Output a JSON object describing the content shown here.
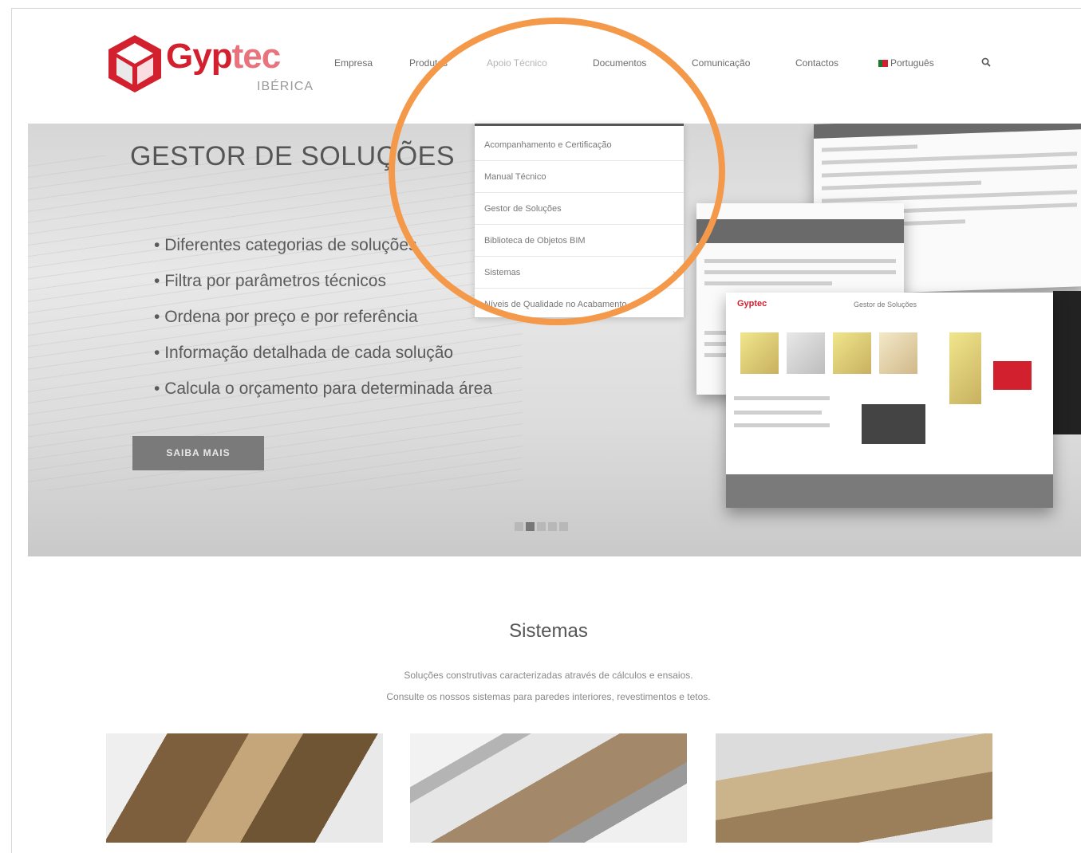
{
  "brand": {
    "name_part1": "Gyp",
    "name_part2": "tec",
    "sub": "IBÉRICA",
    "color": "#d3202f"
  },
  "nav": {
    "items": [
      "Empresa",
      "Produtos",
      "Apoio Técnico",
      "Documentos",
      "Comunicação",
      "Contactos"
    ],
    "language": "Português",
    "active_index": 2
  },
  "hero": {
    "title": "GESTOR DE SOLUÇÕES",
    "bullets": [
      "Diferentes categorias de soluções",
      "Filtra por parâmetros técnicos",
      "Ordena por preço e por referência",
      "Informação detalhada de cada solução",
      "Calcula o orçamento para determinada área"
    ],
    "cta": "SAIBA MAIS",
    "slides_count": 5,
    "active_slide": 2,
    "mock_title": "Gestor de Soluções",
    "mock_brand": "Gyptec"
  },
  "dropdown": {
    "items": [
      "Acompanhamento e Certificação",
      "Manual Técnico",
      "Gestor de Soluções",
      "Biblioteca de Objetos BIM",
      "Sistemas",
      "Níveis de Qualidade no Acabamento"
    ]
  },
  "highlight_color": "#f4994a",
  "section": {
    "title": "Sistemas",
    "desc_line1": "Soluções construtivas caracterizadas através de cálculos e ensaios.",
    "desc_line2": "Consulte os nossos sistemas para paredes interiores, revestimentos e tetos."
  },
  "icons": {
    "search": "search-icon",
    "flag": "portugal-flag-icon",
    "submenu": "chevron-right-icon"
  }
}
